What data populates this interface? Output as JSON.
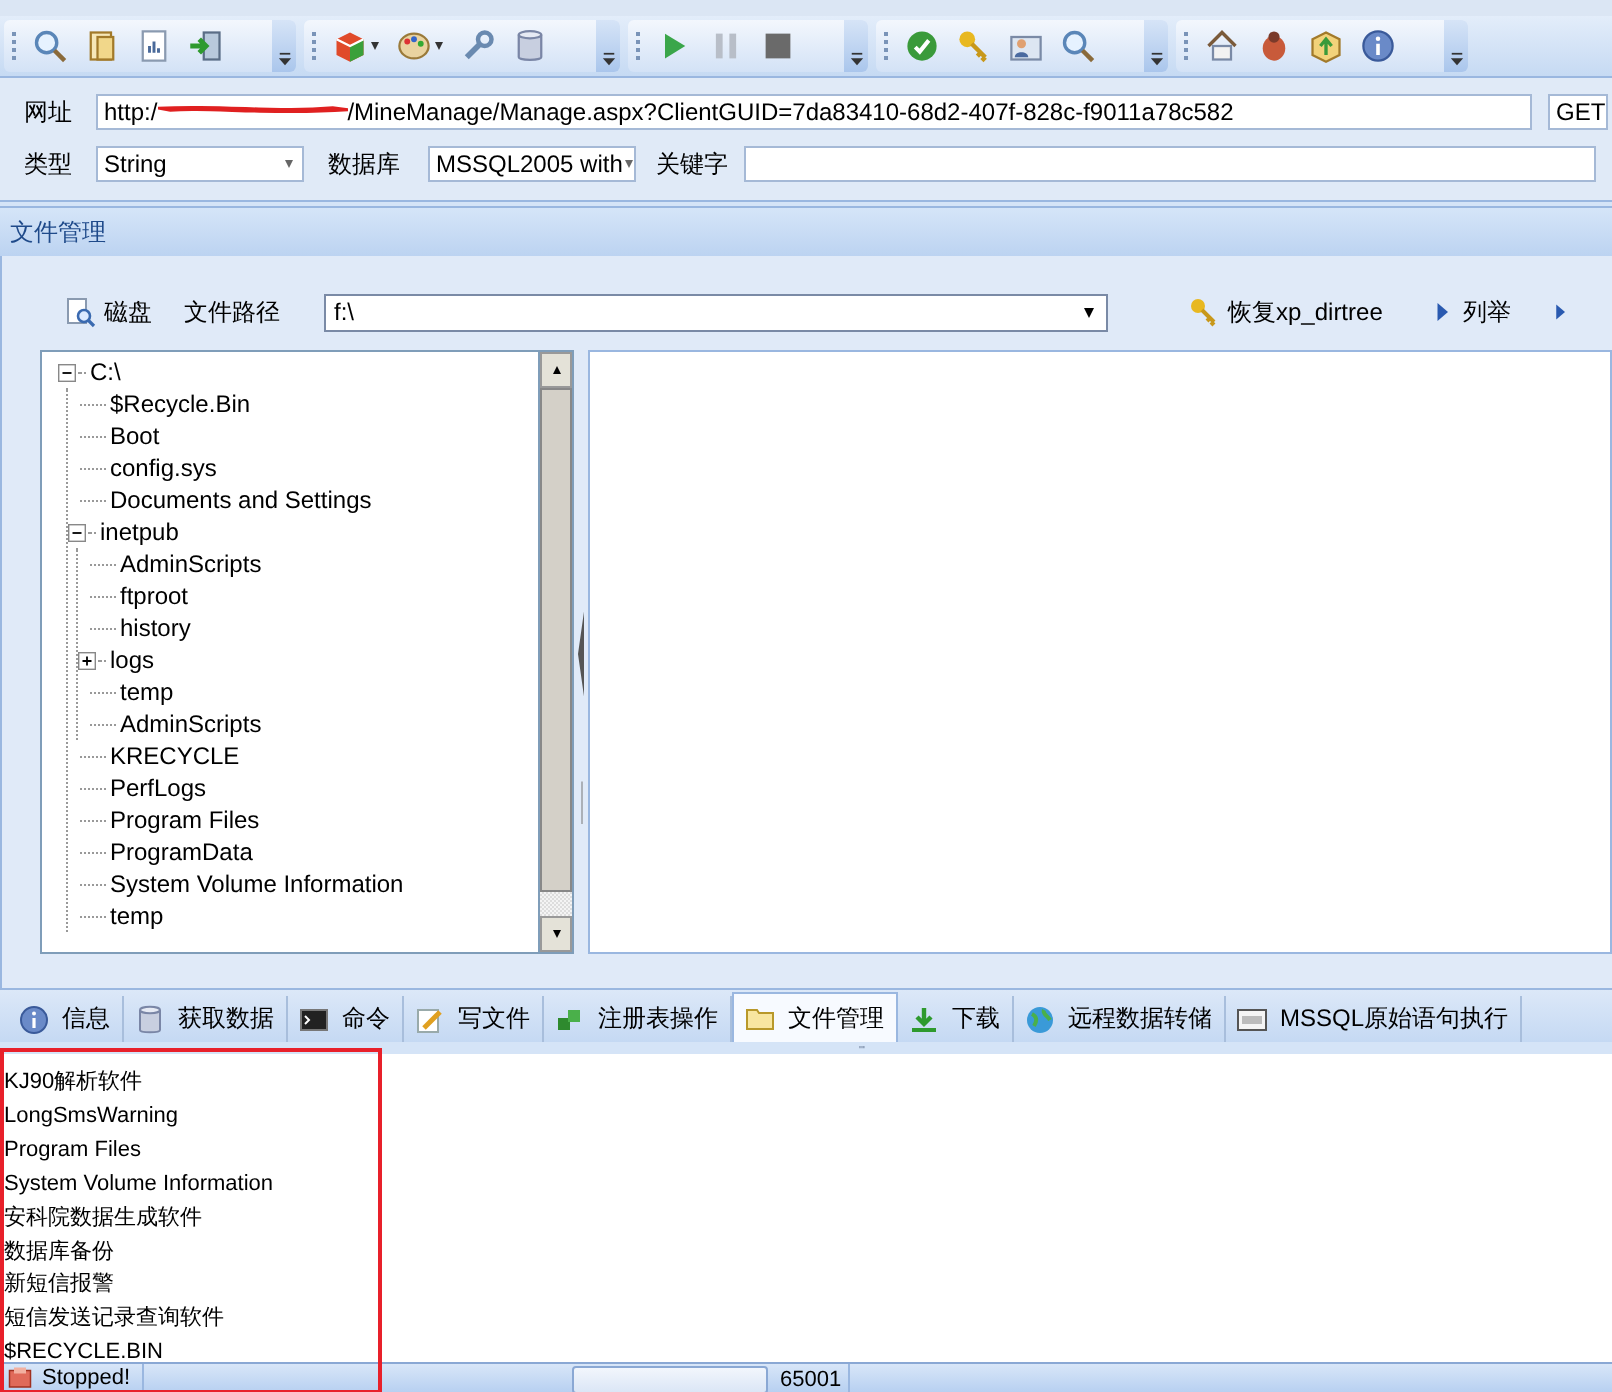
{
  "url": {
    "label": "网址",
    "prefix": "http:/",
    "value": "/MineManage/Manage.aspx?ClientGUID=7da83410-68d2-407f-828c-f9011a78c582",
    "method": "GET"
  },
  "type_field": {
    "label": "类型",
    "value": "String"
  },
  "database_field": {
    "label": "数据库",
    "value": "MSSQL2005 with"
  },
  "keyword_field": {
    "label": "关键字"
  },
  "section_title": "文件管理",
  "file_toolbar": {
    "disk_button": "磁盘",
    "path_label": "文件路径",
    "path": "f:\\",
    "restore_button": "恢复xp_dirtree",
    "list_button": "列举"
  },
  "tree": [
    {
      "label": "C:\\",
      "expanded": true,
      "children": [
        {
          "label": "$Recycle.Bin"
        },
        {
          "label": "Boot"
        },
        {
          "label": "config.sys"
        },
        {
          "label": "Documents and Settings"
        },
        {
          "label": "inetpub",
          "expanded": true,
          "children": [
            {
              "label": "AdminScripts"
            },
            {
              "label": "ftproot"
            },
            {
              "label": "history"
            },
            {
              "label": "logs",
              "expanded": false
            },
            {
              "label": "temp"
            },
            {
              "label": "AdminScripts"
            }
          ]
        },
        {
          "label": "KRECYCLE"
        },
        {
          "label": "PerfLogs"
        },
        {
          "label": "Program Files"
        },
        {
          "label": "ProgramData"
        },
        {
          "label": "System Volume Information"
        },
        {
          "label": "temp"
        }
      ]
    }
  ],
  "tabs": [
    {
      "label": "信息",
      "selected": false
    },
    {
      "label": "获取数据",
      "selected": false
    },
    {
      "label": "命令",
      "selected": false
    },
    {
      "label": "写文件",
      "selected": false
    },
    {
      "label": "注册表操作",
      "selected": false
    },
    {
      "label": "文件管理",
      "selected": true
    },
    {
      "label": "下载",
      "selected": false
    },
    {
      "label": "远程数据转储",
      "selected": false
    },
    {
      "label": "MSSQL原始语句执行",
      "selected": false
    }
  ],
  "output": [
    "KJ90解析软件",
    "LongSmsWarning",
    "Program Files",
    "System Volume Information",
    "安科院数据生成软件",
    "数据库备份",
    "新短信报警",
    "短信发送记录查询软件",
    "$RECYCLE.BIN"
  ],
  "status_bar": {
    "state": "Stopped!",
    "code": "65001"
  }
}
